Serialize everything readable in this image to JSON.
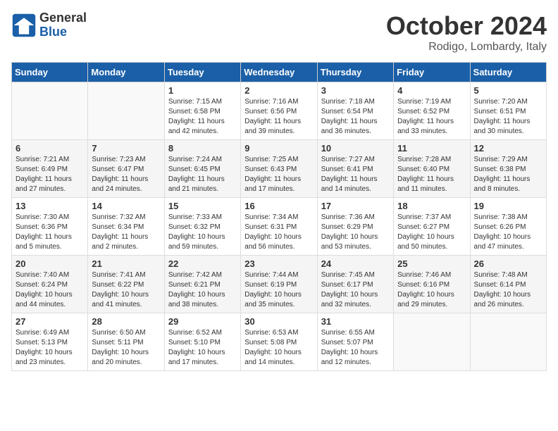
{
  "logo": {
    "general": "General",
    "blue": "Blue"
  },
  "header": {
    "month": "October 2024",
    "location": "Rodigo, Lombardy, Italy"
  },
  "weekdays": [
    "Sunday",
    "Monday",
    "Tuesday",
    "Wednesday",
    "Thursday",
    "Friday",
    "Saturday"
  ],
  "weeks": [
    [
      {
        "day": "",
        "info": ""
      },
      {
        "day": "",
        "info": ""
      },
      {
        "day": "1",
        "info": "Sunrise: 7:15 AM\nSunset: 6:58 PM\nDaylight: 11 hours and 42 minutes."
      },
      {
        "day": "2",
        "info": "Sunrise: 7:16 AM\nSunset: 6:56 PM\nDaylight: 11 hours and 39 minutes."
      },
      {
        "day": "3",
        "info": "Sunrise: 7:18 AM\nSunset: 6:54 PM\nDaylight: 11 hours and 36 minutes."
      },
      {
        "day": "4",
        "info": "Sunrise: 7:19 AM\nSunset: 6:52 PM\nDaylight: 11 hours and 33 minutes."
      },
      {
        "day": "5",
        "info": "Sunrise: 7:20 AM\nSunset: 6:51 PM\nDaylight: 11 hours and 30 minutes."
      }
    ],
    [
      {
        "day": "6",
        "info": "Sunrise: 7:21 AM\nSunset: 6:49 PM\nDaylight: 11 hours and 27 minutes."
      },
      {
        "day": "7",
        "info": "Sunrise: 7:23 AM\nSunset: 6:47 PM\nDaylight: 11 hours and 24 minutes."
      },
      {
        "day": "8",
        "info": "Sunrise: 7:24 AM\nSunset: 6:45 PM\nDaylight: 11 hours and 21 minutes."
      },
      {
        "day": "9",
        "info": "Sunrise: 7:25 AM\nSunset: 6:43 PM\nDaylight: 11 hours and 17 minutes."
      },
      {
        "day": "10",
        "info": "Sunrise: 7:27 AM\nSunset: 6:41 PM\nDaylight: 11 hours and 14 minutes."
      },
      {
        "day": "11",
        "info": "Sunrise: 7:28 AM\nSunset: 6:40 PM\nDaylight: 11 hours and 11 minutes."
      },
      {
        "day": "12",
        "info": "Sunrise: 7:29 AM\nSunset: 6:38 PM\nDaylight: 11 hours and 8 minutes."
      }
    ],
    [
      {
        "day": "13",
        "info": "Sunrise: 7:30 AM\nSunset: 6:36 PM\nDaylight: 11 hours and 5 minutes."
      },
      {
        "day": "14",
        "info": "Sunrise: 7:32 AM\nSunset: 6:34 PM\nDaylight: 11 hours and 2 minutes."
      },
      {
        "day": "15",
        "info": "Sunrise: 7:33 AM\nSunset: 6:32 PM\nDaylight: 10 hours and 59 minutes."
      },
      {
        "day": "16",
        "info": "Sunrise: 7:34 AM\nSunset: 6:31 PM\nDaylight: 10 hours and 56 minutes."
      },
      {
        "day": "17",
        "info": "Sunrise: 7:36 AM\nSunset: 6:29 PM\nDaylight: 10 hours and 53 minutes."
      },
      {
        "day": "18",
        "info": "Sunrise: 7:37 AM\nSunset: 6:27 PM\nDaylight: 10 hours and 50 minutes."
      },
      {
        "day": "19",
        "info": "Sunrise: 7:38 AM\nSunset: 6:26 PM\nDaylight: 10 hours and 47 minutes."
      }
    ],
    [
      {
        "day": "20",
        "info": "Sunrise: 7:40 AM\nSunset: 6:24 PM\nDaylight: 10 hours and 44 minutes."
      },
      {
        "day": "21",
        "info": "Sunrise: 7:41 AM\nSunset: 6:22 PM\nDaylight: 10 hours and 41 minutes."
      },
      {
        "day": "22",
        "info": "Sunrise: 7:42 AM\nSunset: 6:21 PM\nDaylight: 10 hours and 38 minutes."
      },
      {
        "day": "23",
        "info": "Sunrise: 7:44 AM\nSunset: 6:19 PM\nDaylight: 10 hours and 35 minutes."
      },
      {
        "day": "24",
        "info": "Sunrise: 7:45 AM\nSunset: 6:17 PM\nDaylight: 10 hours and 32 minutes."
      },
      {
        "day": "25",
        "info": "Sunrise: 7:46 AM\nSunset: 6:16 PM\nDaylight: 10 hours and 29 minutes."
      },
      {
        "day": "26",
        "info": "Sunrise: 7:48 AM\nSunset: 6:14 PM\nDaylight: 10 hours and 26 minutes."
      }
    ],
    [
      {
        "day": "27",
        "info": "Sunrise: 6:49 AM\nSunset: 5:13 PM\nDaylight: 10 hours and 23 minutes."
      },
      {
        "day": "28",
        "info": "Sunrise: 6:50 AM\nSunset: 5:11 PM\nDaylight: 10 hours and 20 minutes."
      },
      {
        "day": "29",
        "info": "Sunrise: 6:52 AM\nSunset: 5:10 PM\nDaylight: 10 hours and 17 minutes."
      },
      {
        "day": "30",
        "info": "Sunrise: 6:53 AM\nSunset: 5:08 PM\nDaylight: 10 hours and 14 minutes."
      },
      {
        "day": "31",
        "info": "Sunrise: 6:55 AM\nSunset: 5:07 PM\nDaylight: 10 hours and 12 minutes."
      },
      {
        "day": "",
        "info": ""
      },
      {
        "day": "",
        "info": ""
      }
    ]
  ]
}
